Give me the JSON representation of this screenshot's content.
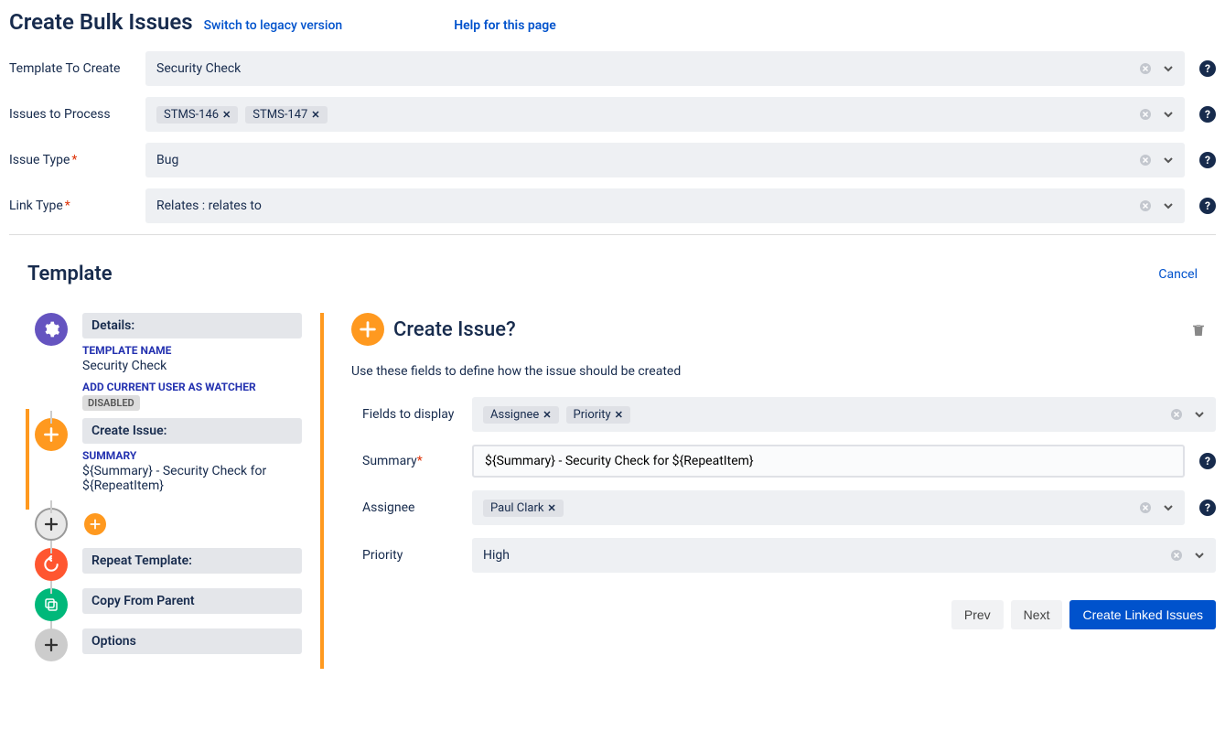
{
  "header": {
    "title": "Create Bulk Issues",
    "legacy_link": "Switch to legacy version",
    "help_link": "Help for this page"
  },
  "form": {
    "template_label": "Template To Create",
    "template_value": "Security Check",
    "issues_label": "Issues to Process",
    "issues_tags": [
      "STMS-146",
      "STMS-147"
    ],
    "issue_type_label": "Issue Type",
    "issue_type_required": "*",
    "issue_type_value": "Bug",
    "link_type_label": "Link Type",
    "link_type_required": "*",
    "link_type_value": "Relates : relates to"
  },
  "template_section": {
    "heading": "Template",
    "cancel": "Cancel"
  },
  "tree": {
    "details": {
      "header": "Details:",
      "name_label": "TEMPLATE NAME",
      "name_value": "Security Check",
      "watcher_label": "ADD CURRENT USER AS WATCHER",
      "watcher_badge": "DISABLED"
    },
    "create_issue": {
      "header": "Create Issue:",
      "summary_label": "SUMMARY",
      "summary_value": "${Summary} - Security Check for ${RepeatItem}"
    },
    "repeat": {
      "header": "Repeat Template:"
    },
    "copy": {
      "header": "Copy From Parent"
    },
    "options": {
      "header": "Options"
    }
  },
  "detail": {
    "title": "Create Issue?",
    "desc": "Use these fields to define how the issue should be created",
    "fields_label": "Fields to display",
    "fields_tags": [
      "Assignee",
      "Priority"
    ],
    "summary_label": "Summary",
    "summary_required": "*",
    "summary_value": "${Summary} - Security Check for ${RepeatItem}",
    "assignee_label": "Assignee",
    "assignee_tags": [
      "Paul Clark"
    ],
    "priority_label": "Priority",
    "priority_value": "High"
  },
  "actions": {
    "prev": "Prev",
    "next": "Next",
    "create": "Create Linked Issues"
  }
}
